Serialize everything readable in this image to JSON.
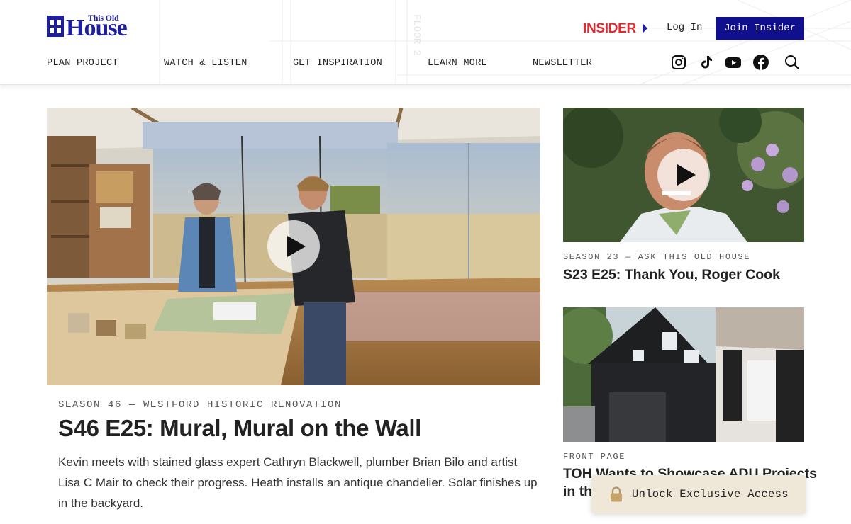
{
  "header": {
    "logo_small": "This Old",
    "logo_big": "House",
    "insider_label": "INSIDER",
    "login_label": "Log In",
    "join_label": "Join Insider",
    "nav": [
      "PLAN PROJECT",
      "WATCH & LISTEN",
      "GET INSPIRATION",
      "LEARN MORE",
      "NEWSLETTER"
    ],
    "social_icons": [
      "instagram-icon",
      "tiktok-icon",
      "youtube-icon",
      "facebook-icon",
      "search-icon"
    ]
  },
  "feature": {
    "eyebrow": "SEASON 46 — WESTFORD HISTORIC RENOVATION",
    "title": "S46 E25: Mural, Mural on the Wall",
    "description": "Kevin meets with stained glass expert Cathryn Blackwell, plumber Brian Bilo and artist Lisa C Mair to check their progress. Heath installs an antique chandelier. Solar finishes up in the backyard."
  },
  "side_articles": [
    {
      "eyebrow": "SEASON 23 — ASK THIS OLD HOUSE",
      "title": "S23 E25: Thank You, Roger Cook"
    },
    {
      "eyebrow": "FRONT PAGE",
      "title": "TOH Wants to Showcase ADU Projects",
      "title_line2": "in th"
    }
  ],
  "unlock": {
    "label": "Unlock Exclusive Access"
  },
  "colors": {
    "brand_blue": "#1d1f9e",
    "insider_red": "#e02a2f",
    "join_bg": "#10108f",
    "unlock_bg": "#efe8d8"
  }
}
